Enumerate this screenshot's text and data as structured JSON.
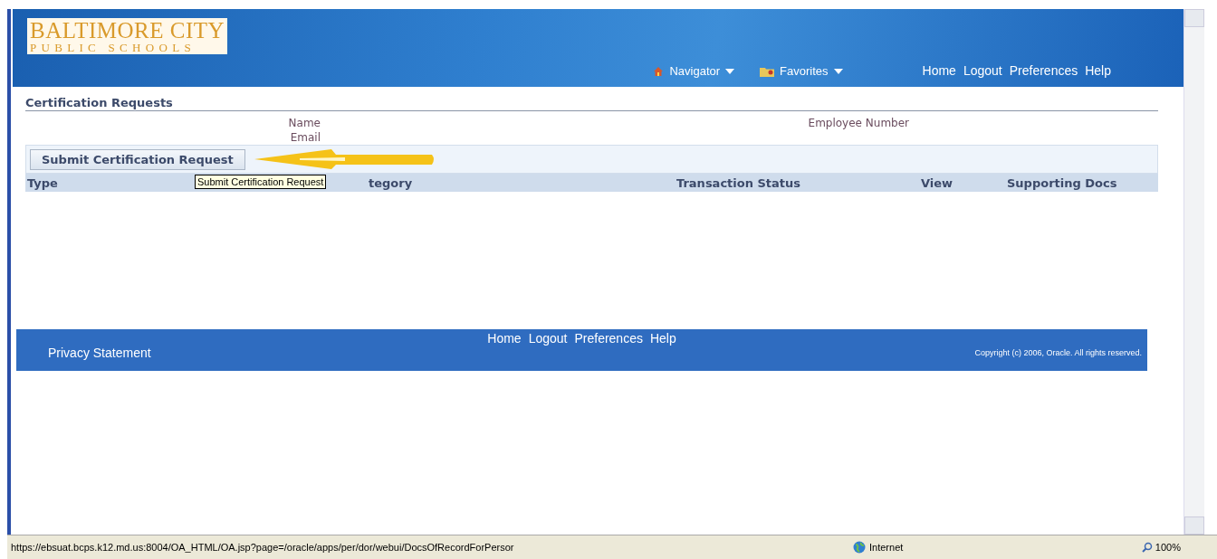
{
  "header": {
    "logo_line_1": "BALTIMORE CITY",
    "logo_line_2": "PUBLIC SCHOOLS",
    "menus": [
      {
        "label": "Navigator",
        "kind": "home"
      },
      {
        "label": "Favorites",
        "kind": "folder"
      }
    ],
    "links": [
      "Home",
      "Logout",
      "Preferences",
      "Help"
    ]
  },
  "section_title": "Certification Requests",
  "fields": {
    "name_label": "Name",
    "email_label": "Email",
    "employee_number_label": "Employee Number"
  },
  "action_button": "Submit Certification Request",
  "tooltip": "Submit Certification Request",
  "table": {
    "columns": [
      "Type",
      "tegory",
      "Transaction Status",
      "View",
      "Supporting Docs"
    ]
  },
  "footer": {
    "links": [
      "Home",
      "Logout",
      "Preferences",
      "Help"
    ],
    "privacy": "Privacy Statement",
    "copyright": "Copyright (c) 2006, Oracle. All rights reserved."
  },
  "status_bar": {
    "url": "https://ebsuat.bcps.k12.md.us:8004/OA_HTML/OA.jsp?page=/oracle/apps/per/dor/webui/DocsOfRecordForPersor",
    "zone": "Internet",
    "zoom": "100%"
  }
}
